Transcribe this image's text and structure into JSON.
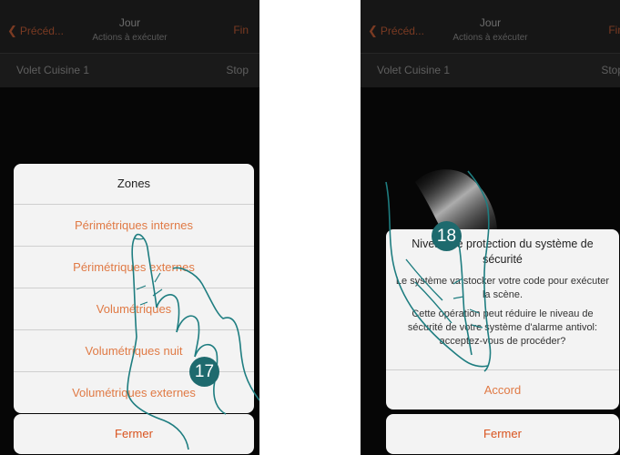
{
  "screen_left": {
    "nav": {
      "back_label": "Précéd...",
      "title": "Jour",
      "subtitle": "Actions à exécuter",
      "done_label": "Fin"
    },
    "row": {
      "label": "Volet Cuisine 1",
      "value": "Stop"
    },
    "sheet": {
      "title": "Zones",
      "items": [
        "Périmétriques internes",
        "Périmétriques externes",
        "Volumétriques",
        "Volumétriques nuit",
        "Volumétriques externes"
      ],
      "close_label": "Fermer"
    },
    "step_badge": "17"
  },
  "screen_right": {
    "nav": {
      "back_label": "Précéd...",
      "title": "Jour",
      "subtitle": "Actions à exécuter",
      "done_label": "Fin"
    },
    "row": {
      "label": "Volet Cuisine 1",
      "value": "Stop"
    },
    "alert": {
      "title": "Niveau de protection du système de sécurité",
      "message_1": "Le système va stocker votre code pour exécuter la scène.",
      "message_2": "Cette opération peut réduire le niveau de sécurité de votre système d'alarme antivol: acceptez-vous de procéder?",
      "button_label": "Accord"
    },
    "close_label": "Fermer",
    "step_badge": "18"
  },
  "colors": {
    "accent": "#e07a45",
    "close_red": "#d9531e",
    "badge": "#1e6a6e",
    "hand_outline": "#1e7d80"
  }
}
